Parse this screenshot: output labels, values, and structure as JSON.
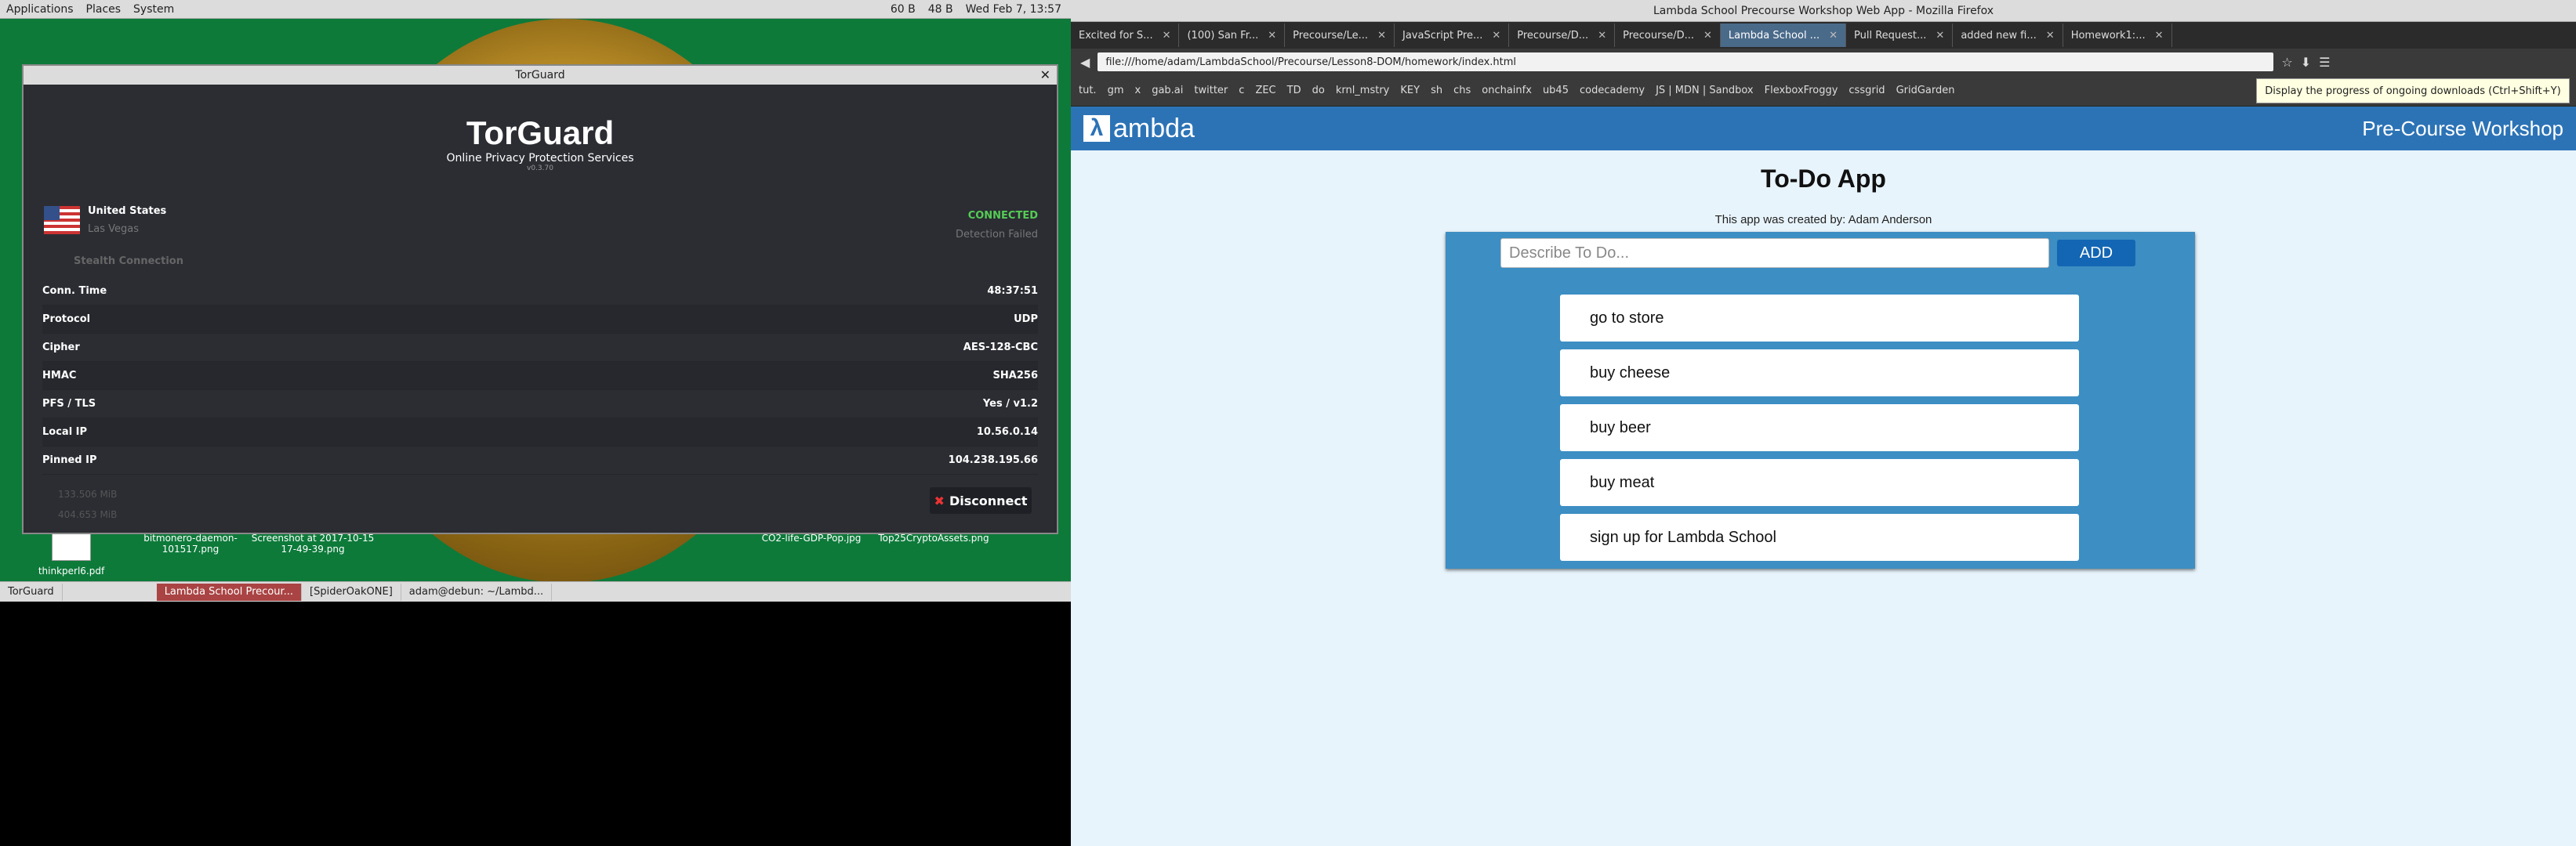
{
  "left": {
    "panel": {
      "menus": [
        "Applications",
        "Places",
        "System"
      ],
      "net_down": "60 B",
      "net_up": "48 B",
      "clock": "Wed Feb 7, 13:57"
    },
    "desktop_icons": [
      {
        "label": "thinkperl6.pdf"
      },
      {
        "label": "bitmonero-daemon-101517.png"
      },
      {
        "label": "Screenshot at 2017-10-15 17-49-39.png"
      },
      {
        "label": "CO2-life-GDP-Pop.jpg"
      },
      {
        "label": "Top25CryptoAssets.png"
      }
    ],
    "torguard": {
      "window_title": "TorGuard",
      "brand": "TorGuard",
      "tagline": "Online Privacy Protection Services",
      "version": "v0.3.70",
      "country": "United States",
      "city": "Las Vegas",
      "status": "CONNECTED",
      "detection": "Detection Failed",
      "stealth": "Stealth Connection",
      "rows": [
        {
          "label": "Conn. Time",
          "value": "48:37:51"
        },
        {
          "label": "Protocol",
          "value": "UDP"
        },
        {
          "label": "Cipher",
          "value": "AES-128-CBC"
        },
        {
          "label": "HMAC",
          "value": "SHA256"
        },
        {
          "label": "PFS / TLS",
          "value": "Yes / v1.2"
        },
        {
          "label": "Local IP",
          "value": "10.56.0.14"
        },
        {
          "label": "Pinned IP",
          "value": "104.238.195.66"
        }
      ],
      "upload": "133.506 MiB",
      "download": "404.653 MiB",
      "disconnect_label": "Disconnect"
    },
    "taskbar": [
      {
        "label": "TorGuard"
      },
      {
        "label": "Lambda School Precour..."
      },
      {
        "label": "[SpiderOakONE]"
      },
      {
        "label": "adam@debun: ~/Lambd..."
      }
    ]
  },
  "firefox": {
    "window_title": "Lambda School Precourse Workshop Web App - Mozilla Firefox",
    "tabs": [
      {
        "label": "Excited for S..."
      },
      {
        "label": "(100) San Fr..."
      },
      {
        "label": "Precourse/Le..."
      },
      {
        "label": "JavaScript Pre..."
      },
      {
        "label": "Precourse/D..."
      },
      {
        "label": "Precourse/D..."
      },
      {
        "label": "Lambda School ..."
      },
      {
        "label": "Pull Request..."
      },
      {
        "label": "added new fi..."
      },
      {
        "label": "Homework1:..."
      }
    ],
    "url": "file:///home/adam/LambdaSchool/Precourse/Lesson8-DOM/homework/index.html",
    "bookmarks": [
      "tut.",
      "gm",
      "x",
      "gab.ai",
      "twitter",
      "c",
      "ZEC",
      "TD",
      "do",
      "krnl_mstry",
      "KEY",
      "sh",
      "chs",
      "onchainfx",
      "ub45",
      "codecademy",
      "JS | MDN | Sandbox",
      "FlexboxFroggy",
      "cssgrid",
      "GridGarden"
    ],
    "tooltip": "Display the progress of ongoing downloads (Ctrl+Shift+Y)"
  },
  "page": {
    "logo_text": "ambda",
    "workshop": "Pre-Course Workshop",
    "title": "To-Do App",
    "creator": "This app was created by: Adam Anderson",
    "input_placeholder": "Describe To Do...",
    "add_label": "ADD",
    "todos": [
      "go to store",
      "buy cheese",
      "buy beer",
      "buy meat",
      "sign up for Lambda School"
    ]
  }
}
